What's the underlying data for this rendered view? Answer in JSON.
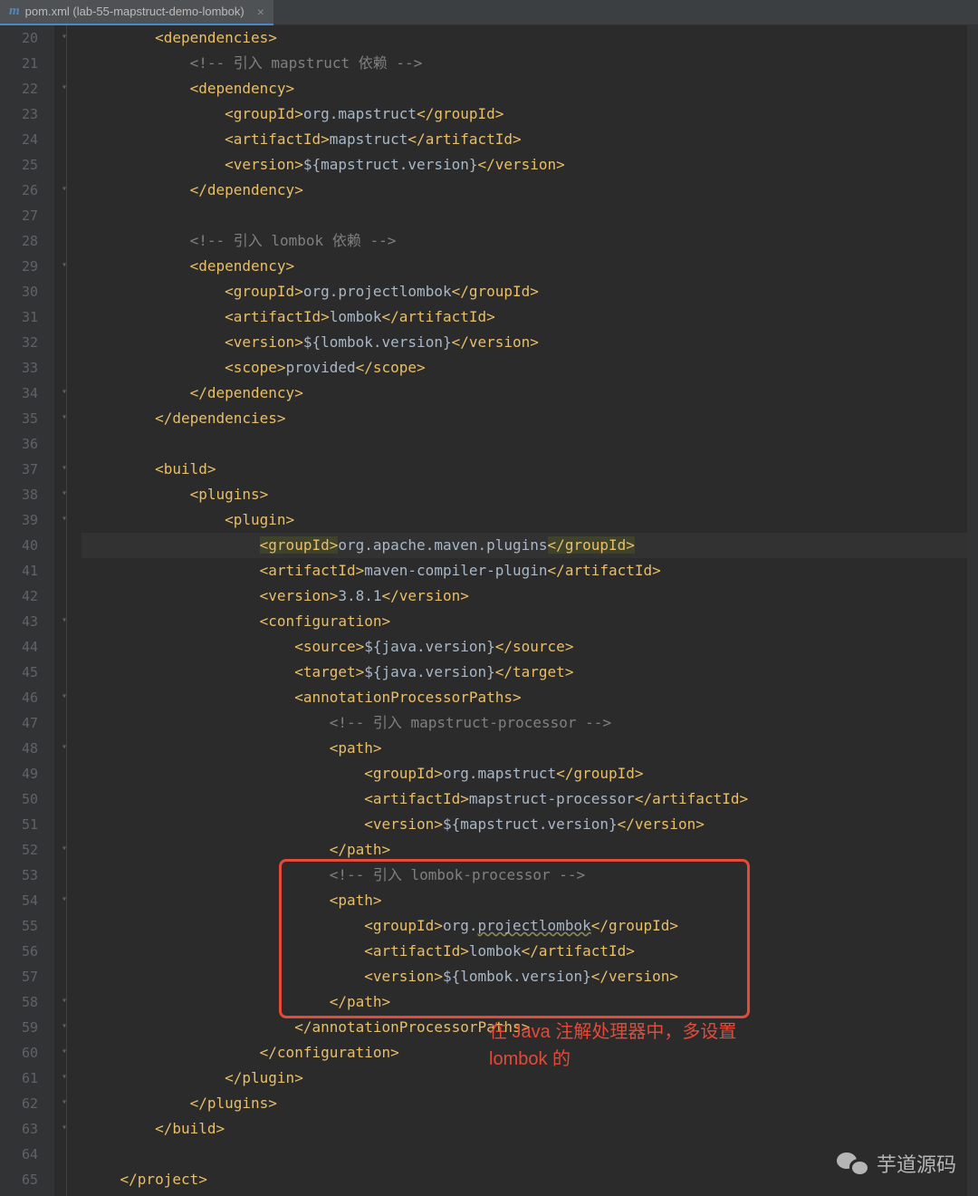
{
  "tab": {
    "icon": "m",
    "title": "pom.xml (lab-55-mapstruct-demo-lombok)",
    "close": "×"
  },
  "gutter_start": 20,
  "highlight_line": 40,
  "code": [
    {
      "indent": 2,
      "tokens": [
        [
          "t-tag",
          "<dependencies>"
        ]
      ]
    },
    {
      "indent": 3,
      "tokens": [
        [
          "t-comment",
          "<!-- 引入 mapstruct 依赖 -->"
        ]
      ]
    },
    {
      "indent": 3,
      "tokens": [
        [
          "t-tag",
          "<dependency>"
        ]
      ]
    },
    {
      "indent": 4,
      "tokens": [
        [
          "t-tag",
          "<groupId>"
        ],
        [
          "t-text",
          "org.mapstruct"
        ],
        [
          "t-tag",
          "</groupId>"
        ]
      ]
    },
    {
      "indent": 4,
      "tokens": [
        [
          "t-tag",
          "<artifactId>"
        ],
        [
          "t-text",
          "mapstruct"
        ],
        [
          "t-tag",
          "</artifactId>"
        ]
      ]
    },
    {
      "indent": 4,
      "tokens": [
        [
          "t-tag",
          "<version>"
        ],
        [
          "t-text",
          "${mapstruct.version}"
        ],
        [
          "t-tag",
          "</version>"
        ]
      ]
    },
    {
      "indent": 3,
      "tokens": [
        [
          "t-tag",
          "</dependency>"
        ]
      ]
    },
    {
      "indent": 0,
      "tokens": []
    },
    {
      "indent": 3,
      "tokens": [
        [
          "t-comment",
          "<!-- 引入 lombok 依赖 -->"
        ]
      ]
    },
    {
      "indent": 3,
      "tokens": [
        [
          "t-tag",
          "<dependency>"
        ]
      ]
    },
    {
      "indent": 4,
      "tokens": [
        [
          "t-tag",
          "<groupId>"
        ],
        [
          "t-text",
          "org.projectlombok"
        ],
        [
          "t-tag",
          "</groupId>"
        ]
      ]
    },
    {
      "indent": 4,
      "tokens": [
        [
          "t-tag",
          "<artifactId>"
        ],
        [
          "t-text",
          "lombok"
        ],
        [
          "t-tag",
          "</artifactId>"
        ]
      ]
    },
    {
      "indent": 4,
      "tokens": [
        [
          "t-tag",
          "<version>"
        ],
        [
          "t-text",
          "${lombok.version}"
        ],
        [
          "t-tag",
          "</version>"
        ]
      ]
    },
    {
      "indent": 4,
      "tokens": [
        [
          "t-tag",
          "<scope>"
        ],
        [
          "t-text",
          "provided"
        ],
        [
          "t-tag",
          "</scope>"
        ]
      ]
    },
    {
      "indent": 3,
      "tokens": [
        [
          "t-tag",
          "</dependency>"
        ]
      ]
    },
    {
      "indent": 2,
      "tokens": [
        [
          "t-tag",
          "</dependencies>"
        ]
      ]
    },
    {
      "indent": 0,
      "tokens": []
    },
    {
      "indent": 2,
      "tokens": [
        [
          "t-tag",
          "<build>"
        ]
      ]
    },
    {
      "indent": 3,
      "tokens": [
        [
          "t-tag",
          "<plugins>"
        ]
      ]
    },
    {
      "indent": 4,
      "tokens": [
        [
          "t-tag",
          "<plugin>"
        ]
      ]
    },
    {
      "indent": 5,
      "hl_row": true,
      "tokens": [
        [
          "t-tag hl-y",
          "<groupId>"
        ],
        [
          "t-text",
          "org.apache.maven.plugins"
        ],
        [
          "t-tag hl-y",
          "</groupId>"
        ]
      ]
    },
    {
      "indent": 5,
      "tokens": [
        [
          "t-tag",
          "<artifactId>"
        ],
        [
          "t-text",
          "maven-compiler-plugin"
        ],
        [
          "t-tag",
          "</artifactId>"
        ]
      ]
    },
    {
      "indent": 5,
      "tokens": [
        [
          "t-tag",
          "<version>"
        ],
        [
          "t-text",
          "3.8.1"
        ],
        [
          "t-tag",
          "</version>"
        ]
      ]
    },
    {
      "indent": 5,
      "tokens": [
        [
          "t-tag",
          "<configuration>"
        ]
      ]
    },
    {
      "indent": 6,
      "tokens": [
        [
          "t-tag",
          "<source>"
        ],
        [
          "t-text",
          "${java.version}"
        ],
        [
          "t-tag",
          "</source>"
        ]
      ]
    },
    {
      "indent": 6,
      "tokens": [
        [
          "t-tag",
          "<target>"
        ],
        [
          "t-text",
          "${java.version}"
        ],
        [
          "t-tag",
          "</target>"
        ]
      ]
    },
    {
      "indent": 6,
      "tokens": [
        [
          "t-tag",
          "<annotationProcessorPaths>"
        ]
      ]
    },
    {
      "indent": 7,
      "tokens": [
        [
          "t-comment",
          "<!-- 引入 mapstruct-processor -->"
        ]
      ]
    },
    {
      "indent": 7,
      "tokens": [
        [
          "t-tag",
          "<path>"
        ]
      ]
    },
    {
      "indent": 8,
      "tokens": [
        [
          "t-tag",
          "<groupId>"
        ],
        [
          "t-text",
          "org.mapstruct"
        ],
        [
          "t-tag",
          "</groupId>"
        ]
      ]
    },
    {
      "indent": 8,
      "tokens": [
        [
          "t-tag",
          "<artifactId>"
        ],
        [
          "t-text",
          "mapstruct-processor"
        ],
        [
          "t-tag",
          "</artifactId>"
        ]
      ]
    },
    {
      "indent": 8,
      "tokens": [
        [
          "t-tag",
          "<version>"
        ],
        [
          "t-text",
          "${mapstruct.version}"
        ],
        [
          "t-tag",
          "</version>"
        ]
      ]
    },
    {
      "indent": 7,
      "tokens": [
        [
          "t-tag",
          "</path>"
        ]
      ]
    },
    {
      "indent": 7,
      "tokens": [
        [
          "t-comment",
          "<!-- 引入 lombok-processor -->"
        ]
      ]
    },
    {
      "indent": 7,
      "tokens": [
        [
          "t-tag",
          "<path>"
        ]
      ]
    },
    {
      "indent": 8,
      "tokens": [
        [
          "t-tag",
          "<groupId>"
        ],
        [
          "t-text",
          "org."
        ],
        [
          "t-text underline-wavy",
          "projectlombok"
        ],
        [
          "t-tag",
          "</groupId>"
        ]
      ]
    },
    {
      "indent": 8,
      "tokens": [
        [
          "t-tag",
          "<artifactId>"
        ],
        [
          "t-text",
          "lombok"
        ],
        [
          "t-tag",
          "</artifactId>"
        ]
      ]
    },
    {
      "indent": 8,
      "tokens": [
        [
          "t-tag",
          "<version>"
        ],
        [
          "t-text",
          "${lombok.version}"
        ],
        [
          "t-tag",
          "</version>"
        ]
      ]
    },
    {
      "indent": 7,
      "tokens": [
        [
          "t-tag",
          "</path>"
        ]
      ]
    },
    {
      "indent": 6,
      "tokens": [
        [
          "t-tag",
          "</annotationProcessorPaths>"
        ]
      ]
    },
    {
      "indent": 5,
      "tokens": [
        [
          "t-tag",
          "</configuration>"
        ]
      ]
    },
    {
      "indent": 4,
      "tokens": [
        [
          "t-tag",
          "</plugin>"
        ]
      ]
    },
    {
      "indent": 3,
      "tokens": [
        [
          "t-tag",
          "</plugins>"
        ]
      ]
    },
    {
      "indent": 2,
      "tokens": [
        [
          "t-tag",
          "</build>"
        ]
      ]
    },
    {
      "indent": 0,
      "tokens": []
    },
    {
      "indent": 1,
      "tokens": [
        [
          "t-tag",
          "</project>"
        ]
      ]
    }
  ],
  "annotation": "在 Java 注解处理器中，多设置\nlombok 的",
  "watermark": "芋道源码"
}
